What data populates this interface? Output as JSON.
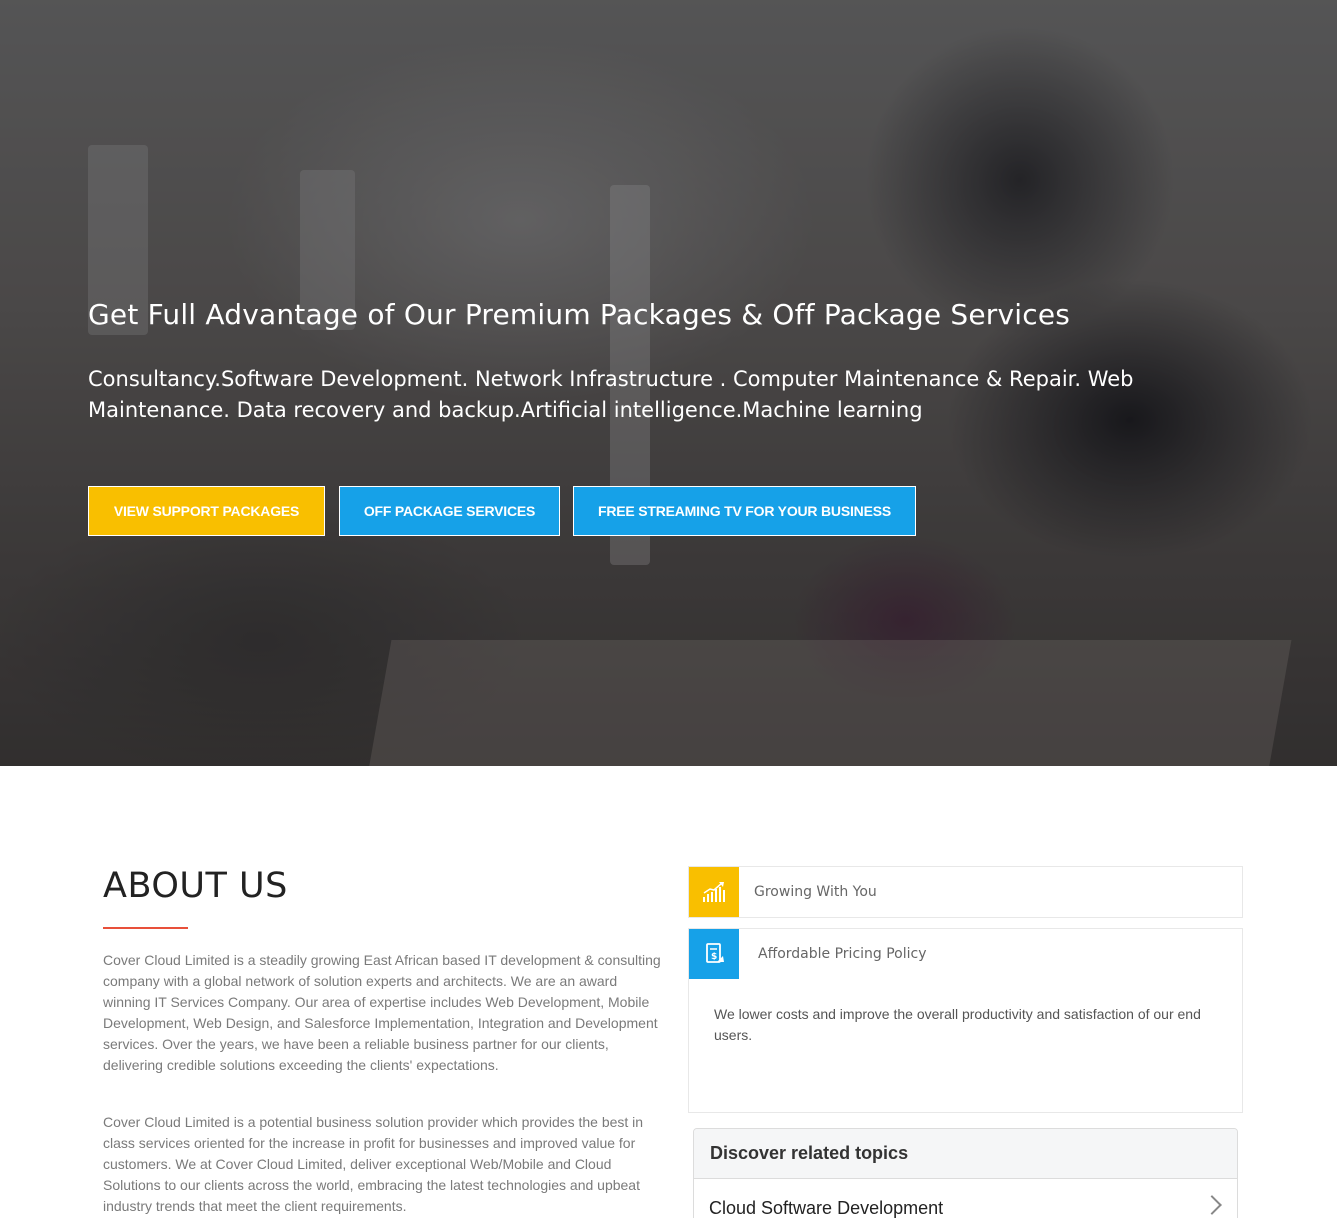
{
  "hero": {
    "title": "Get Full Advantage of Our Premium Packages & Off Package Services",
    "subtitle": "Consultancy.Software Development. Network Infrastructure . Computer Maintenance & Repair. Web Maintenance. Data recovery and backup.Artificial intelligence.Machine learning",
    "buttons": [
      {
        "label": "VIEW SUPPORT PACKAGES",
        "color": "#f9bf00"
      },
      {
        "label": "OFF PACKAGE SERVICES",
        "color": "#16a1e8"
      },
      {
        "label": "FREE STREAMING TV FOR YOUR BUSINESS",
        "color": "#16a1e8"
      }
    ]
  },
  "about": {
    "title": "ABOUT US",
    "accent_color": "#e8503a",
    "paragraphs": [
      "Cover Cloud Limited is a steadily growing East African based IT development & consulting company with a global network of solution experts and architects. We are an award winning IT Services Company. Our area of expertise includes Web Development, Mobile Development, Web Design, and Salesforce Implementation, Integration and Development services. Over the years, we have been a reliable business partner for our clients, delivering credible solutions exceeding the clients' expectations.",
      "Cover Cloud Limited is a potential business solution provider which provides the best in class services oriented for the increase in profit for businesses and improved value for customers. We at Cover Cloud Limited, deliver exceptional Web/Mobile and Cloud Solutions to our clients across the world, embracing the latest technologies and upbeat industry trends that meet the client requirements."
    ]
  },
  "features": {
    "items": [
      {
        "label": "Growing With You",
        "icon": "growth-chart-icon",
        "color": "#f9bf00"
      },
      {
        "label": "Affordable Pricing Policy",
        "icon": "price-tag-icon",
        "color": "#16a1e8"
      }
    ],
    "open_body": "We lower costs and improve the overall productivity and satisfaction of our end users."
  },
  "discover": {
    "heading": "Discover related topics",
    "items": [
      {
        "label": "Cloud Software Development",
        "icon": "chevron-right-icon"
      }
    ]
  }
}
